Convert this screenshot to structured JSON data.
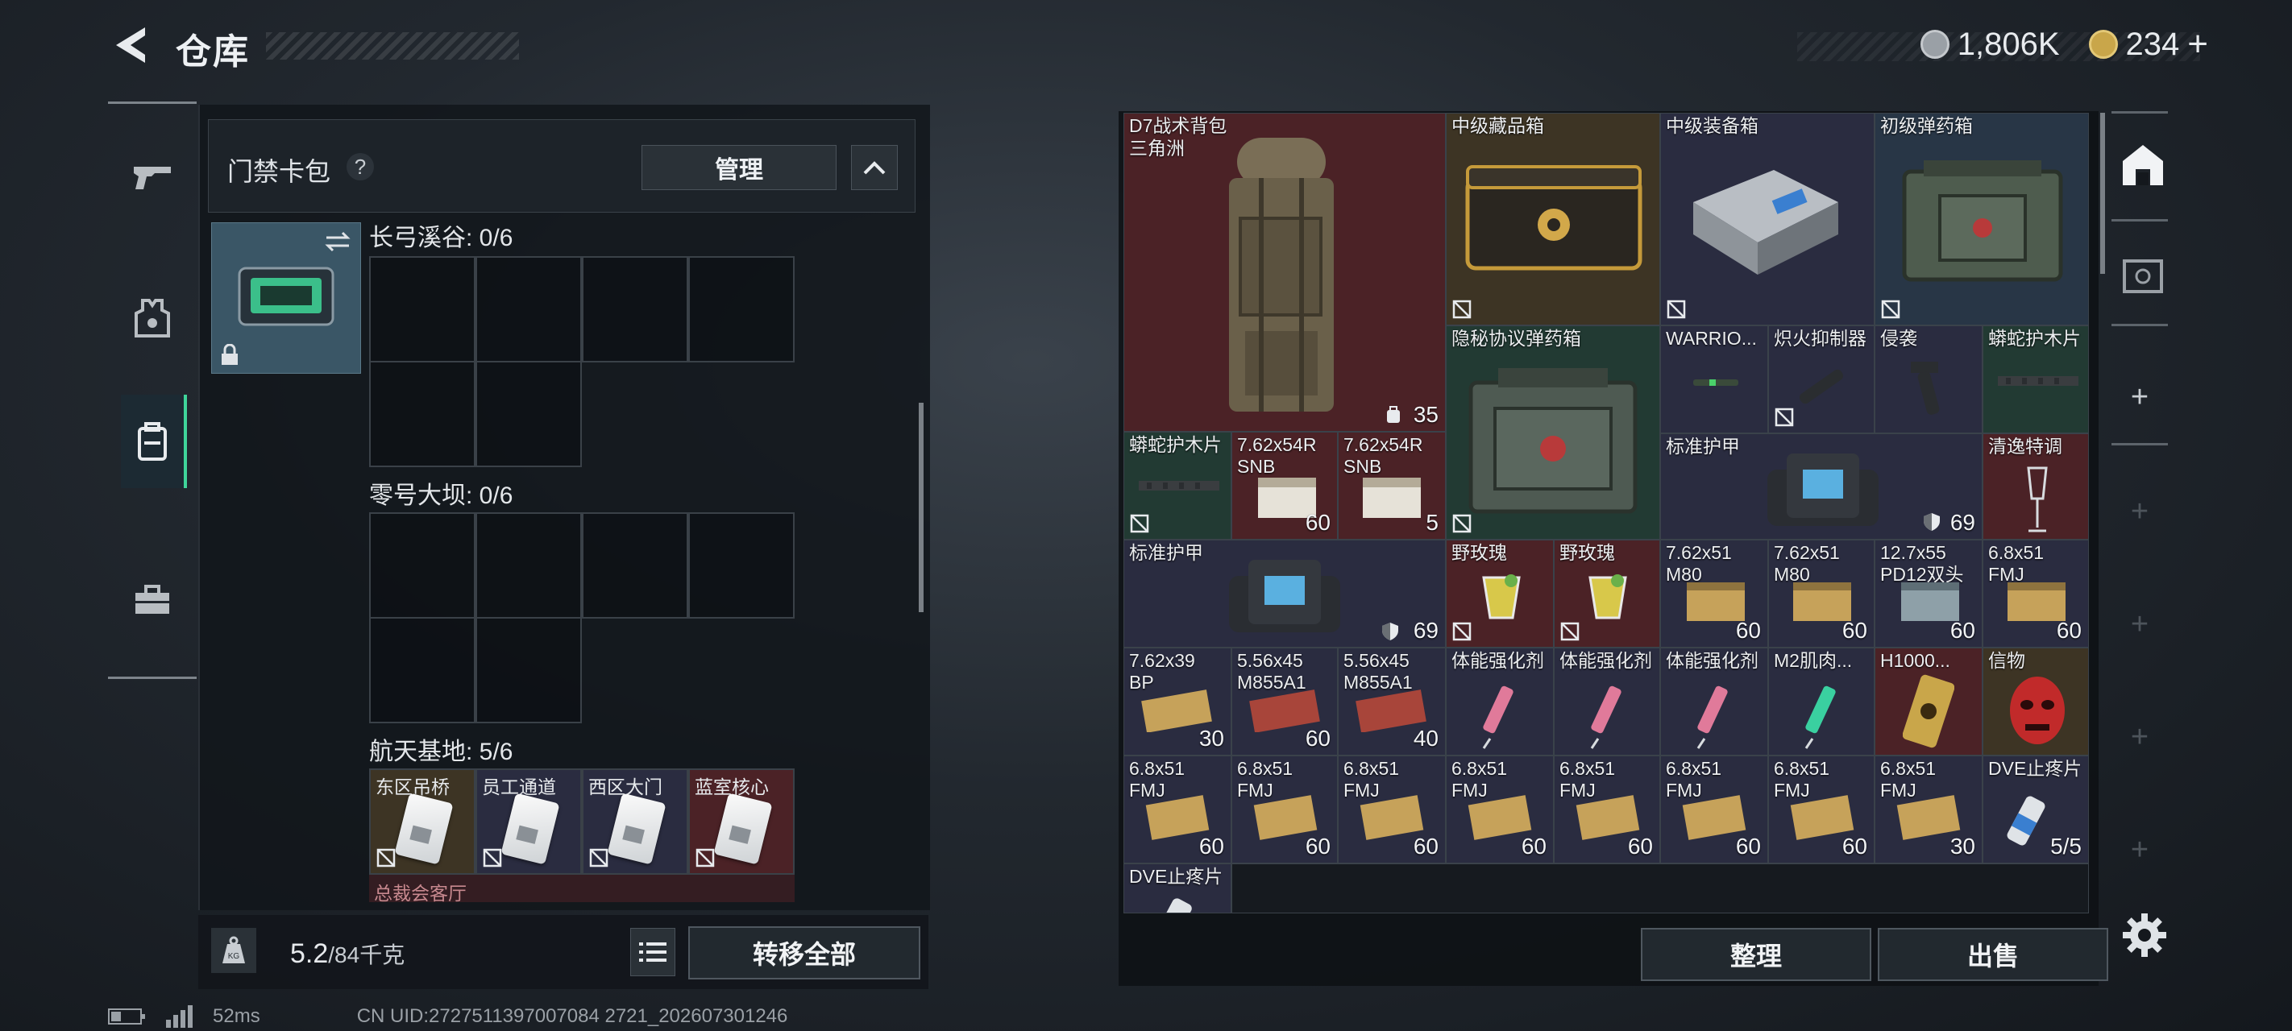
{
  "header": {
    "title": "仓库",
    "currency1": "1,806K",
    "currency2": "234",
    "add": "+"
  },
  "left_nav": {
    "items": [
      "weapon",
      "armor",
      "container",
      "toolbox"
    ],
    "active": 2
  },
  "card_pack": {
    "title": "门禁卡包",
    "help": "?",
    "manage": "管理",
    "sections": [
      {
        "label": "长弓溪谷: 0/6"
      },
      {
        "label": "零号大坝: 0/6"
      },
      {
        "label": "航天基地: 5/6",
        "cards": [
          "东区吊桥",
          "员工通道",
          "西区大门",
          "蓝室核心"
        ],
        "partial_label": "总裁会客厅"
      }
    ]
  },
  "footer_left": {
    "weight_value": "5.2",
    "weight_total": "/84千克",
    "weight_unit_icon": "KG",
    "transfer_all": "转移全部"
  },
  "status": {
    "ping": "52ms",
    "uid": "CN UID:2727511397007084 2721_202607301246"
  },
  "inventory": {
    "backpack": {
      "name": "D7战术背包",
      "sub": "三角洲",
      "count": "35"
    },
    "items": [
      {
        "name": "中级藏品箱"
      },
      {
        "name": "中级装备箱"
      },
      {
        "name": "初级弹药箱"
      },
      {
        "name": "隐秘协议弹药箱"
      },
      {
        "name": "WARRIO..."
      },
      {
        "name": "炽火抑制器"
      },
      {
        "name": "侵袭"
      },
      {
        "name": "蟒蛇护木片"
      },
      {
        "name": "蟒蛇护木片"
      },
      {
        "name": "7.62x54R\nSNB",
        "count": "60"
      },
      {
        "name": "7.62x54R\nSNB",
        "count": "5"
      },
      {
        "name": "标准护甲",
        "count": "69"
      },
      {
        "name": "清逸特调"
      },
      {
        "name": "标准护甲",
        "count": "69"
      },
      {
        "name": "野玫瑰"
      },
      {
        "name": "野玫瑰"
      },
      {
        "name": "7.62x51\nM80",
        "count": "60"
      },
      {
        "name": "7.62x51\nM80",
        "count": "60"
      },
      {
        "name": "12.7x55\nPD12双头",
        "count": "60"
      },
      {
        "name": "6.8x51\nFMJ",
        "count": "60"
      },
      {
        "name": "7.62x39\nBP",
        "count": "30"
      },
      {
        "name": "5.56x45\nM855A1",
        "count": "60"
      },
      {
        "name": "5.56x45\nM855A1",
        "count": "40"
      },
      {
        "name": "体能强化剂"
      },
      {
        "name": "体能强化剂"
      },
      {
        "name": "体能强化剂"
      },
      {
        "name": "M2肌肉..."
      },
      {
        "name": "H1000..."
      },
      {
        "name": "信物"
      },
      {
        "name": "6.8x51\nFMJ",
        "count": "60"
      },
      {
        "name": "6.8x51\nFMJ",
        "count": "60"
      },
      {
        "name": "6.8x51\nFMJ",
        "count": "60"
      },
      {
        "name": "6.8x51\nFMJ",
        "count": "60"
      },
      {
        "name": "6.8x51\nFMJ",
        "count": "60"
      },
      {
        "name": "6.8x51\nFMJ",
        "count": "60"
      },
      {
        "name": "6.8x51\nFMJ",
        "count": "60"
      },
      {
        "name": "6.8x51\nFMJ",
        "count": "30"
      },
      {
        "name": "DVE止疼片",
        "count": "5/5"
      },
      {
        "name": "DVE止疼片"
      }
    ]
  },
  "right_nav": {
    "plus": "+"
  },
  "footer_right": {
    "sort": "整理",
    "sell": "出售"
  },
  "colors": {
    "accent": "#3fd59a",
    "red_tier": "#4b2226",
    "purple_tier": "#2a2c40",
    "blue_tier": "#283646",
    "green_tier": "#223a33",
    "gold_tier": "#3d3424"
  }
}
